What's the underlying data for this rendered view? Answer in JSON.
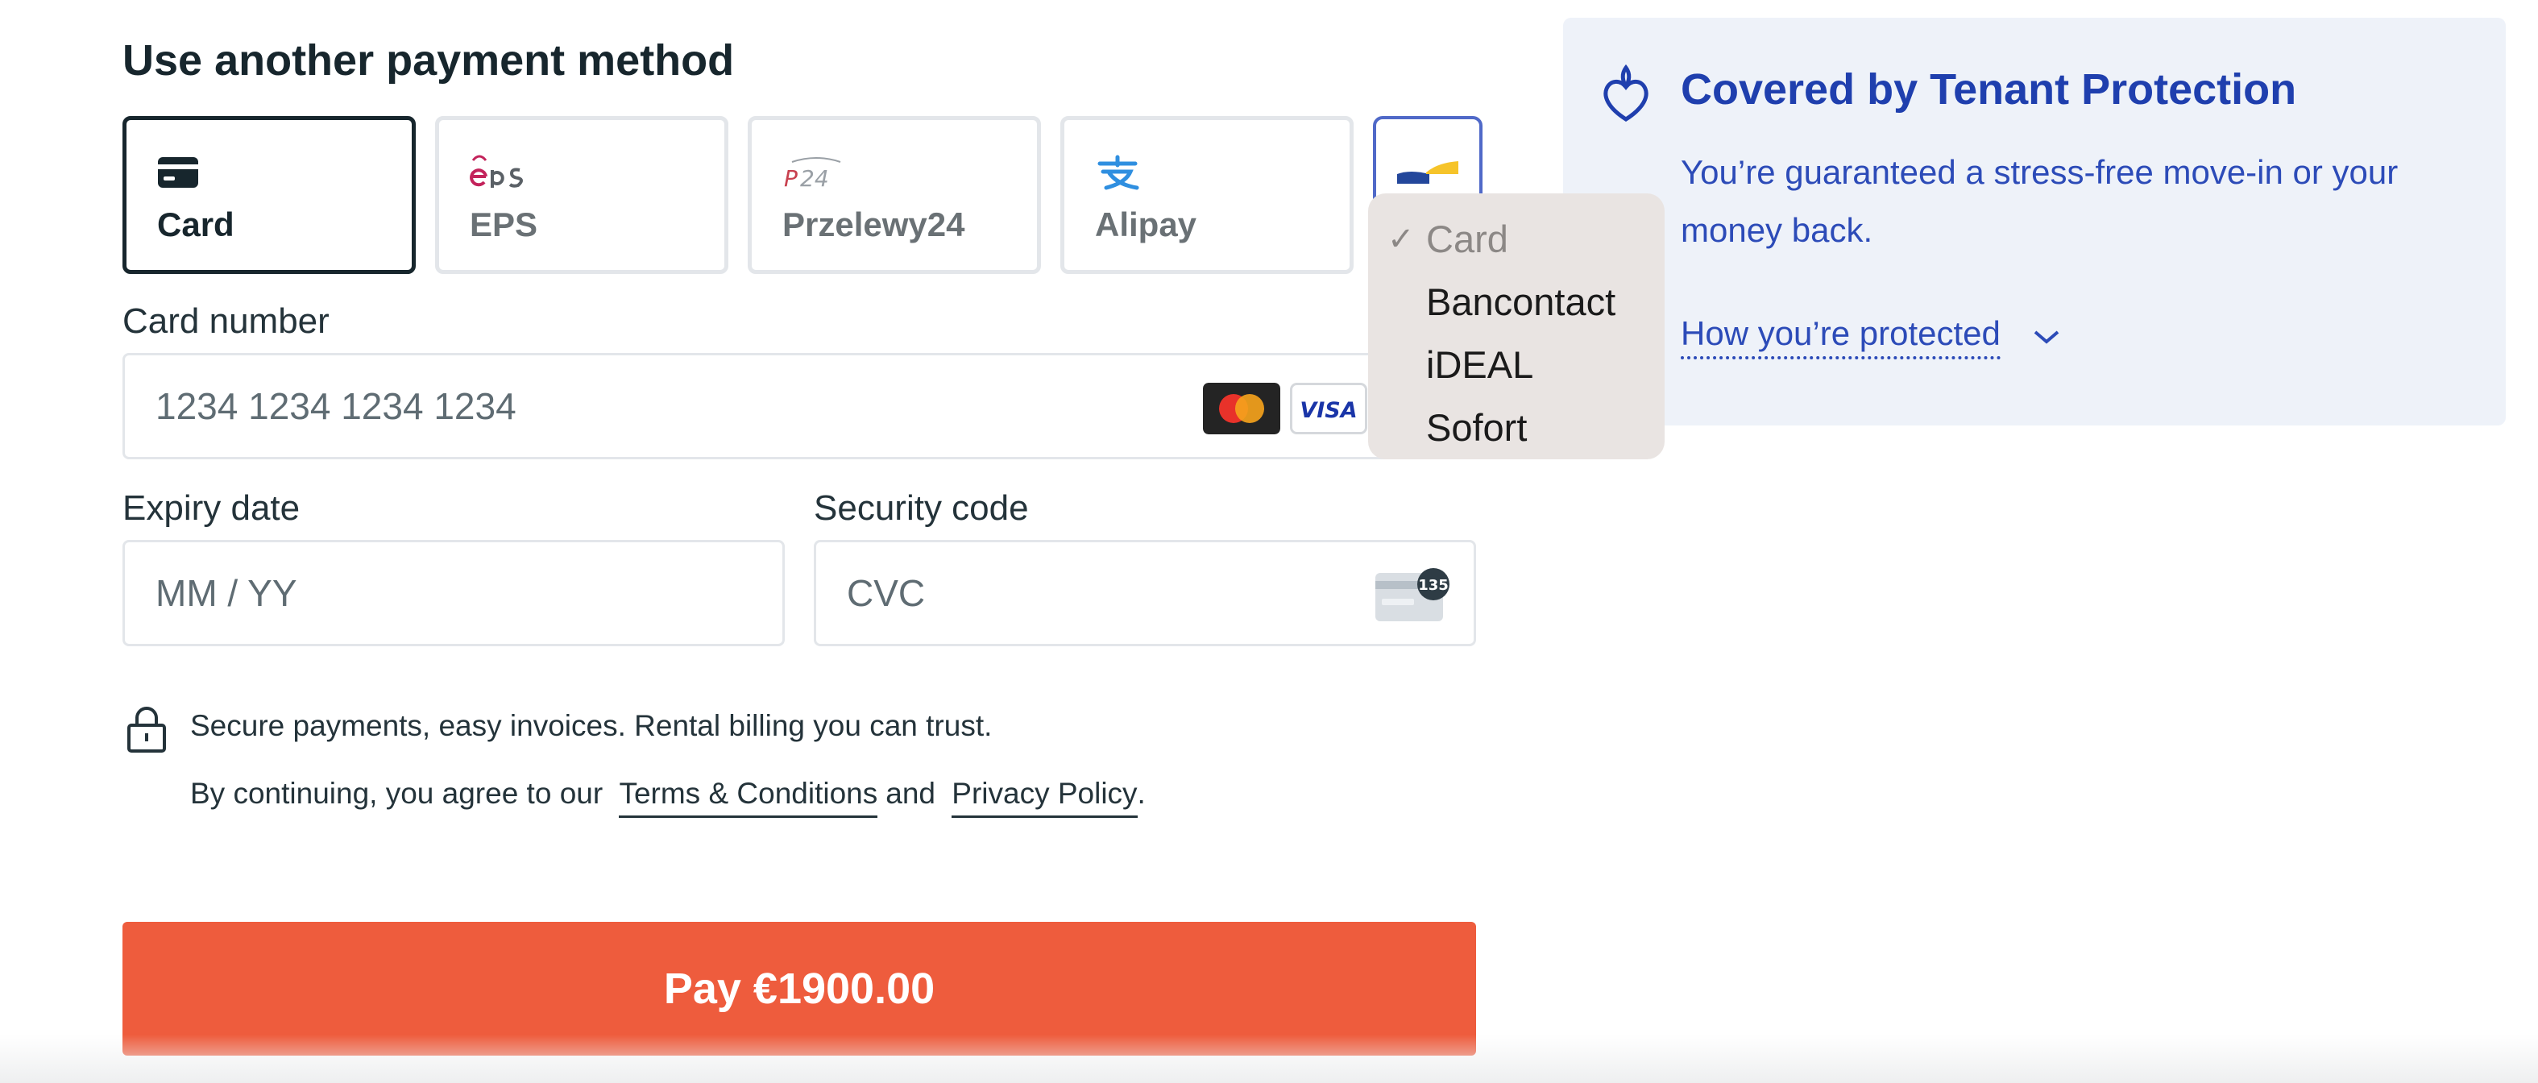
{
  "heading": "Use another payment method",
  "payment_methods": [
    {
      "label": "Card",
      "icon": "credit-card-icon",
      "selected": true
    },
    {
      "label": "EPS",
      "icon": "eps-logo-icon",
      "selected": false
    },
    {
      "label": "Przelewy24",
      "icon": "p24-logo-icon",
      "selected": false
    },
    {
      "label": "Alipay",
      "icon": "alipay-logo-icon",
      "selected": false
    }
  ],
  "more_methods_icon": "more-methods-icon",
  "dropdown": {
    "items": [
      {
        "label": "Card",
        "checked": true
      },
      {
        "label": "Bancontact",
        "checked": false
      },
      {
        "label": "iDEAL",
        "checked": false
      },
      {
        "label": "Sofort",
        "checked": false
      }
    ]
  },
  "card_number": {
    "label": "Card number",
    "placeholder": "1234 1234 1234 1234",
    "brands": [
      "mastercard-icon",
      "visa-icon"
    ],
    "visa_text": "VISA"
  },
  "expiry": {
    "label": "Expiry date",
    "placeholder": "MM / YY"
  },
  "security": {
    "label": "Security code",
    "placeholder": "CVC",
    "cvc_badge": "135"
  },
  "secure_note": "Secure payments, easy invoices. Rental billing you can trust.",
  "agreement": {
    "prefix": "By continuing, you agree to our",
    "terms": "Terms & Conditions",
    "and": "and",
    "privacy": "Privacy Policy",
    "suffix": "."
  },
  "pay_button": "Pay €1900.00",
  "protection": {
    "title": "Covered by Tenant Protection",
    "description": "You’re guaranteed a stress-free move-in or your money back.",
    "link": "How you’re protected"
  },
  "colors": {
    "accent": "#ee5c3d",
    "protection_blue": "#1f3fae",
    "panel_bg": "#eef2f9"
  }
}
